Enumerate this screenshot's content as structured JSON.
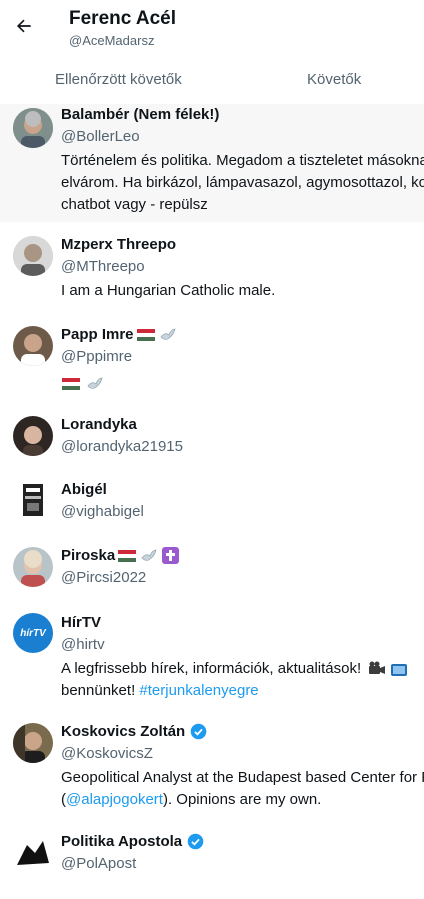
{
  "header": {
    "title": "Ferenc Acél",
    "handle": "@AceMadarsz"
  },
  "tabs": [
    {
      "label": "Ellenőrzött követők"
    },
    {
      "label": "Követők"
    }
  ],
  "users": [
    {
      "name": "Balambér (Nem félek!)",
      "handle": "@BollerLeo",
      "bio": [
        "Történelem és politika. Megadom a tiszteletet másoknak, s",
        "elvárom. Ha birkázol, lámpavasazol, agymosottazol, kommu",
        "chatbot vagy - repülsz"
      ]
    },
    {
      "name": "Mzperx Threepo",
      "handle": "@MThreepo",
      "bio": [
        "I am a Hungarian Catholic male."
      ]
    },
    {
      "name": "Papp Imre",
      "handle": "@Pppimre"
    },
    {
      "name": "Lorandyka",
      "handle": "@lorandyka21915"
    },
    {
      "name": "Abigél",
      "handle": "@vighabigel"
    },
    {
      "name": "Piroska",
      "handle": "@Pircsi2022"
    },
    {
      "name": "HírTV",
      "handle": "@hirtv",
      "bio_line1": "A legfrissebb hírek, információk, aktualitások!",
      "bio_line2_text": "bennünket! ",
      "bio_line2_link": "#terjunkalenyegre",
      "avatar_text": "hírTV"
    },
    {
      "name": "Koskovics Zoltán",
      "handle": "@KoskovicsZ",
      "bio_line1": "Geopolitical Analyst at the Budapest based Center for Fu",
      "bio_line2_pre": "(",
      "bio_line2_link": "@alapjogokert",
      "bio_line2_post": "). Opinions are my own."
    },
    {
      "name": "Politika Apostola",
      "handle": "@PolApost"
    }
  ],
  "colors": {
    "text": "#0f1419",
    "secondary": "#536471",
    "link": "#1d9bf0",
    "highlight_row": "#f7f7f7",
    "verified": "#1d9bf0"
  },
  "icons": [
    "back-arrow-icon",
    "verified-badge-icon",
    "hungarian-flag-icon",
    "dove-icon",
    "cross-icon",
    "camera-icon",
    "tv-icon"
  ]
}
